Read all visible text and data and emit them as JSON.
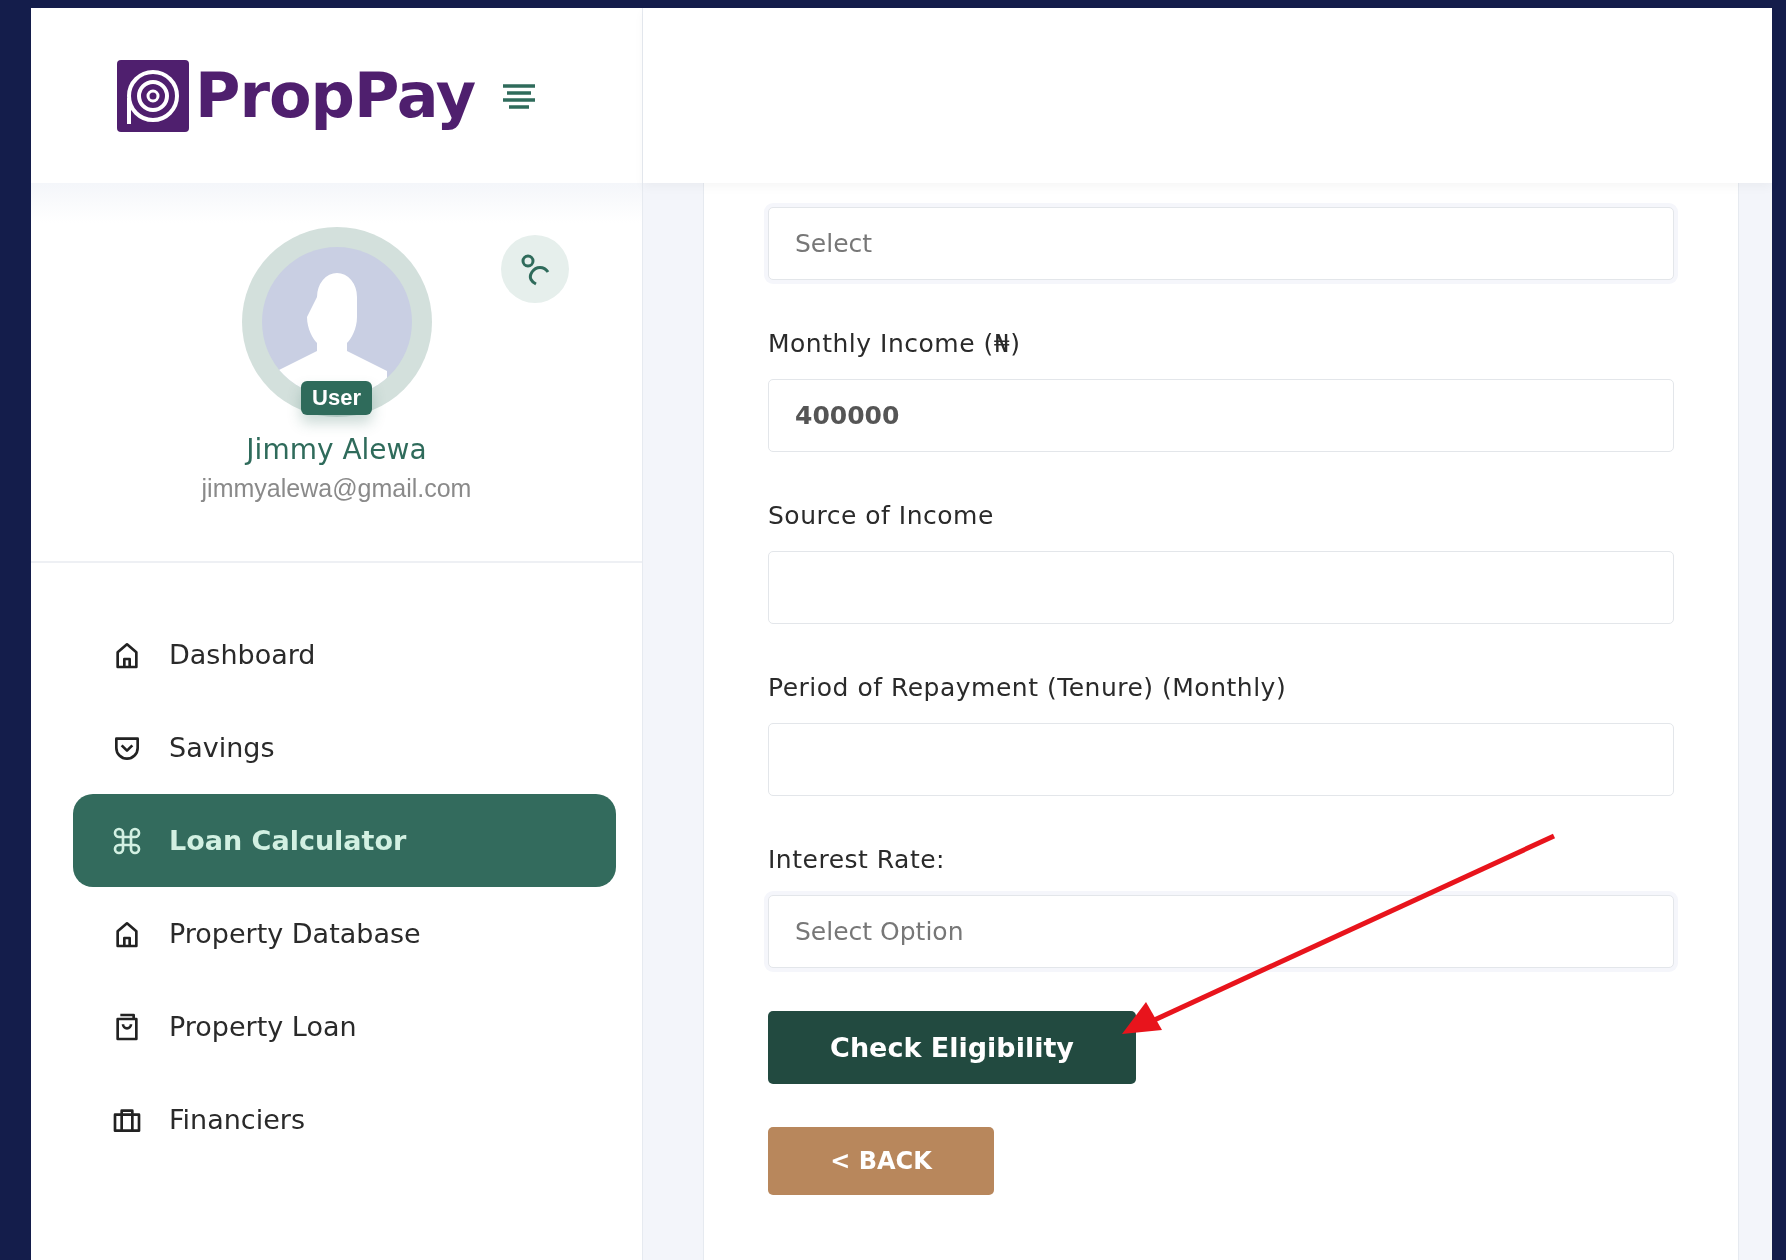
{
  "brand": {
    "name": "PropPay"
  },
  "profile": {
    "role": "User",
    "name": "Jimmy Alewa",
    "email": "jimmyalewa@gmail.com"
  },
  "sidebar": {
    "items": [
      {
        "label": "Dashboard",
        "selected": false
      },
      {
        "label": "Savings",
        "selected": false
      },
      {
        "label": "Loan Calculator",
        "selected": true
      },
      {
        "label": "Property Database",
        "selected": false
      },
      {
        "label": "Property Loan",
        "selected": false
      },
      {
        "label": "Financiers",
        "selected": false
      }
    ]
  },
  "form": {
    "fields": [
      {
        "kind": "select",
        "placeholder": "Select"
      },
      {
        "kind": "input",
        "label": "Monthly Income (₦)",
        "value": "400000"
      },
      {
        "kind": "input",
        "label": "Source of Income"
      },
      {
        "kind": "input",
        "label": "Period of Repayment (Tenure) (Monthly)"
      },
      {
        "kind": "select",
        "label": "Interest Rate:",
        "placeholder": "Select Option"
      }
    ],
    "buttons": [
      {
        "kind": "primary",
        "label": "Check Eligibility"
      },
      {
        "kind": "back",
        "label": "< BACK"
      }
    ]
  }
}
